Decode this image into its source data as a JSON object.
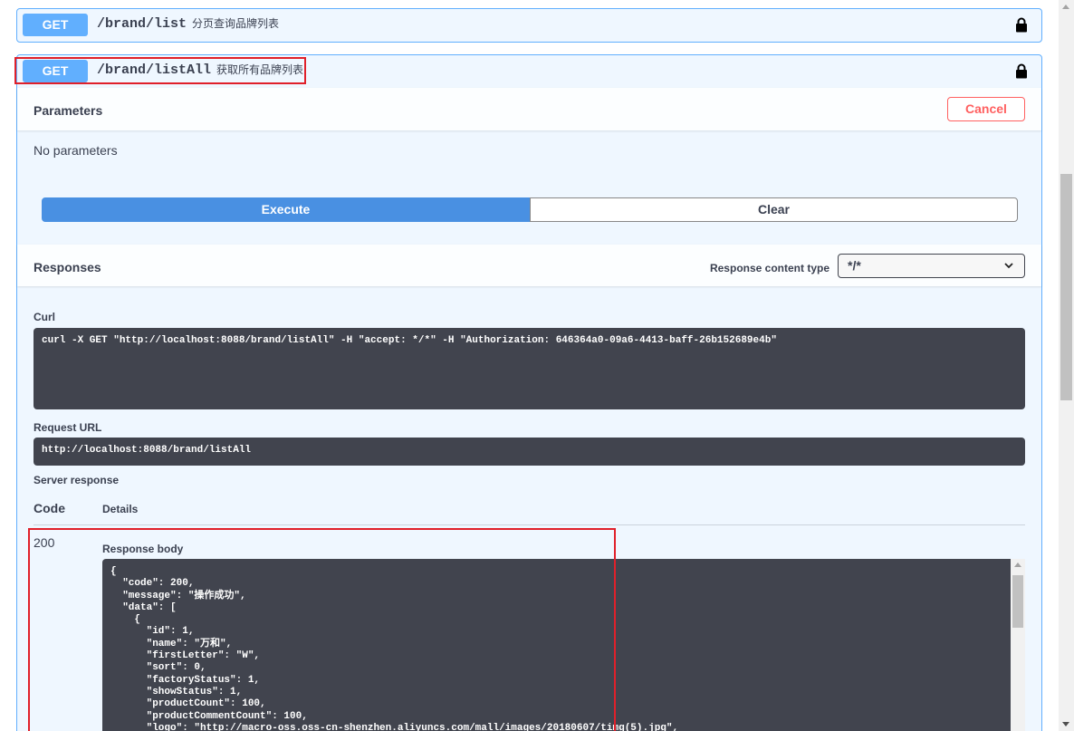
{
  "colors": {
    "method_get": "#61affe",
    "highlight": "#e0202a",
    "code_bg": "#41444e",
    "execute": "#4990e2",
    "cancel": "#ff6060"
  },
  "operations": [
    {
      "method": "GET",
      "path": "/brand/list",
      "description": "分页查询品牌列表",
      "icon": "lock-icon"
    },
    {
      "method": "GET",
      "path": "/brand/listAll",
      "description": "获取所有品牌列表",
      "icon": "lock-icon"
    }
  ],
  "parameters": {
    "title": "Parameters",
    "cancel_label": "Cancel",
    "empty_text": "No parameters"
  },
  "actions": {
    "execute_label": "Execute",
    "clear_label": "Clear"
  },
  "responses": {
    "title": "Responses",
    "content_type_label": "Response content type",
    "content_type_value": "*/*",
    "curl_label": "Curl",
    "curl_command": "curl -X GET \"http://localhost:8088/brand/listAll\" -H \"accept: */*\" -H \"Authorization: 646364a0-09a6-4413-baff-26b152689e4b\"",
    "request_url_label": "Request URL",
    "request_url": "http://localhost:8088/brand/listAll",
    "server_response_label": "Server response",
    "code_header": "Code",
    "details_header": "Details",
    "status_code": "200",
    "response_body_label": "Response body",
    "response_body": "{\n  \"code\": 200,\n  \"message\": \"操作成功\",\n  \"data\": [\n    {\n      \"id\": 1,\n      \"name\": \"万和\",\n      \"firstLetter\": \"W\",\n      \"sort\": 0,\n      \"factoryStatus\": 1,\n      \"showStatus\": 1,\n      \"productCount\": 100,\n      \"productCommentCount\": 100,\n      \"logo\": \"http://macro-oss.oss-cn-shenzhen.aliyuncs.com/mall/images/20180607/timg(5).jpg\","
  }
}
